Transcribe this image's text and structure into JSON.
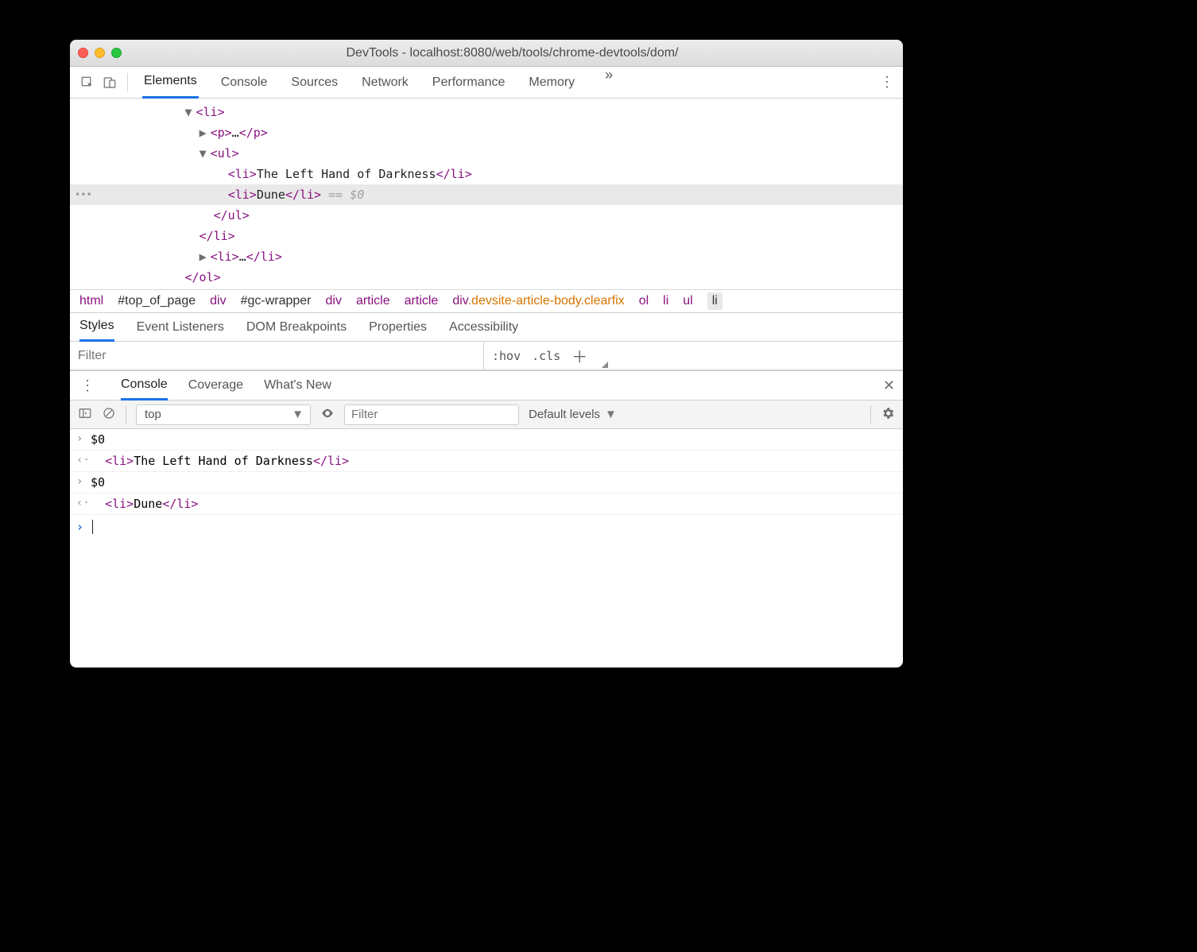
{
  "window": {
    "title": "DevTools - localhost:8080/web/tools/chrome-devtools/dom/"
  },
  "main_tabs": {
    "t0": "Elements",
    "t1": "Console",
    "t2": "Sources",
    "t3": "Network",
    "t4": "Performance",
    "t5": "Memory"
  },
  "dom": {
    "l0_open": "<li>",
    "l1_p": "<p>",
    "l1_p_ell": "…",
    "l1_p_close": "</p>",
    "l2_ul": "<ul>",
    "l3_li_o": "<li>",
    "l3_txt": "The Left Hand of Darkness",
    "l3_li_c": "</li>",
    "l4_li_o": "<li>",
    "l4_txt": "Dune",
    "l4_li_c": "</li>",
    "l4_eq": " == $0",
    "l5_ul_c": "</ul>",
    "l6_li_c": "</li>",
    "l7_li_o": "<li>",
    "l7_ell": "…",
    "l7_li_c": "</li>",
    "l8_ol_c": "</ol>"
  },
  "breadcrumb": {
    "b0": "html",
    "b1": "#top_of_page",
    "b2": "div",
    "b3": "#gc-wrapper",
    "b4": "div",
    "b5": "article",
    "b6": "article",
    "b7_tag": "div",
    "b7_cls": ".devsite-article-body.clearfix",
    "b8": "ol",
    "b9": "li",
    "b10": "ul",
    "b11": "li"
  },
  "sub_tabs": {
    "s0": "Styles",
    "s1": "Event Listeners",
    "s2": "DOM Breakpoints",
    "s3": "Properties",
    "s4": "Accessibility"
  },
  "styles_bar": {
    "filter_placeholder": "Filter",
    "hov": ":hov",
    "cls": ".cls"
  },
  "drawer_tabs": {
    "d0": "Console",
    "d1": "Coverage",
    "d2": "What's New"
  },
  "console_toolbar": {
    "context": "top",
    "filter_placeholder": "Filter",
    "levels": "Default levels"
  },
  "console": {
    "r0": "$0",
    "r1_pre": "  ",
    "r1_li_o": "<li>",
    "r1_txt": "The Left Hand of Darkness",
    "r1_li_c": "</li>",
    "r2": "$0",
    "r3_pre": "  ",
    "r3_li_o": "<li>",
    "r3_txt": "Dune",
    "r3_li_c": "</li>"
  }
}
